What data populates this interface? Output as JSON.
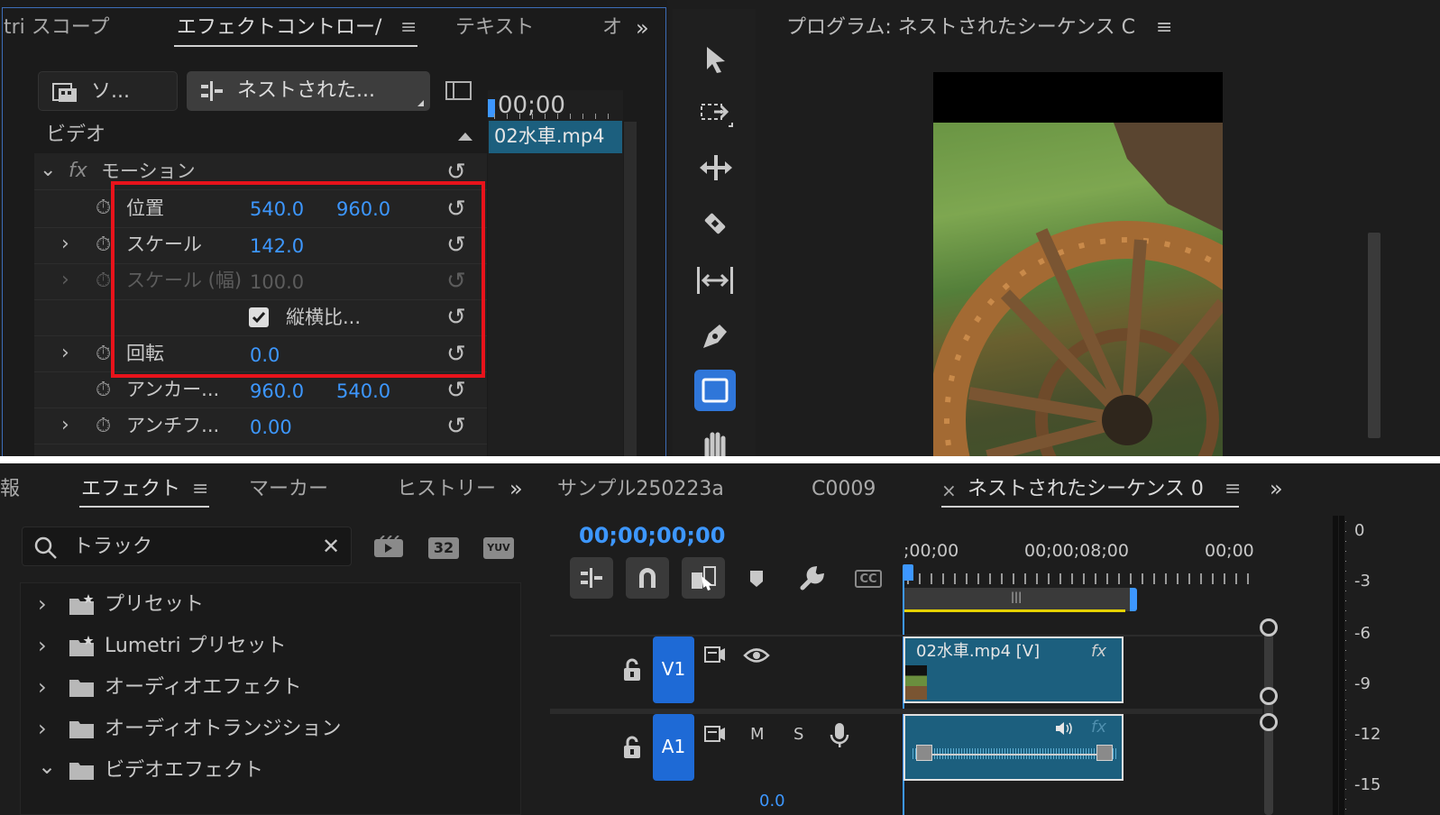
{
  "effect_controls": {
    "tabs": [
      {
        "label": "tri スコープ"
      },
      {
        "label": "エフェクトコントロー/"
      },
      {
        "label": "テキスト"
      },
      {
        "label": "オ"
      }
    ],
    "source_label": "ソ...",
    "sequence_label": "ネストされた...",
    "timecode": "00;00",
    "clip_name": "02水車.mp4",
    "section": "ビデオ",
    "motion": {
      "label": "モーション",
      "fx": "fx",
      "properties": [
        {
          "label": "位置",
          "value1": "540.0",
          "value2": "960.0"
        },
        {
          "label": "スケール",
          "value1": "142.0",
          "value2": ""
        },
        {
          "label": "スケール (幅)",
          "value1": "100.0",
          "value2": ""
        },
        {
          "label": "縦横比...",
          "value1": "",
          "value2": ""
        },
        {
          "label": "回転",
          "value1": "0.0",
          "value2": ""
        },
        {
          "label": "アンカー...",
          "value1": "960.0",
          "value2": "540.0"
        },
        {
          "label": "アンチフ...",
          "value1": "0.00",
          "value2": ""
        }
      ]
    },
    "highlight_color": "#e8131b"
  },
  "program_monitor": {
    "title": "プログラム: ネストされたシーケンス C"
  },
  "effects_panel": {
    "partial_tab": "報",
    "tabs": [
      {
        "label": "エフェクト"
      },
      {
        "label": "マーカー"
      },
      {
        "label": "ヒストリー"
      }
    ],
    "search_value": "トラック",
    "badges": [
      "32",
      "YUV"
    ],
    "tree": [
      {
        "label": "プリセット",
        "icon": "star-folder-icon",
        "expanded": false
      },
      {
        "label": "Lumetri プリセット",
        "icon": "star-folder-icon",
        "expanded": false
      },
      {
        "label": "オーディオエフェクト",
        "icon": "folder-icon",
        "expanded": false
      },
      {
        "label": "オーディオトランジション",
        "icon": "folder-icon",
        "expanded": false
      },
      {
        "label": "ビデオエフェクト",
        "icon": "folder-icon",
        "expanded": true
      }
    ]
  },
  "timeline": {
    "tabs": [
      {
        "label": "サンプル250223a"
      },
      {
        "label": "C0009"
      },
      {
        "label": "ネストされたシーケンス 0"
      }
    ],
    "close_symbol": "×",
    "timecode": "00;00;00;00",
    "ruler": [
      ";00;00",
      "00;00;08;00",
      "00;00"
    ],
    "cc_label": "CC",
    "tracks": [
      {
        "name": "V1",
        "clip": "02水車.mp4 [V]",
        "fx": "fx"
      },
      {
        "name": "A1",
        "m": "M",
        "s": "S",
        "fx": "fx"
      }
    ],
    "bottom_partial": "0.0"
  },
  "audio_meter": {
    "ticks": [
      "0",
      "-3",
      "-6",
      "-9",
      "-12",
      "-15"
    ]
  },
  "colors": {
    "accent_blue": "#3d97ff",
    "track_button": "#1e6ad6",
    "clip_teal": "#1c5f7e",
    "work_area_yellow": "#e6d200"
  }
}
